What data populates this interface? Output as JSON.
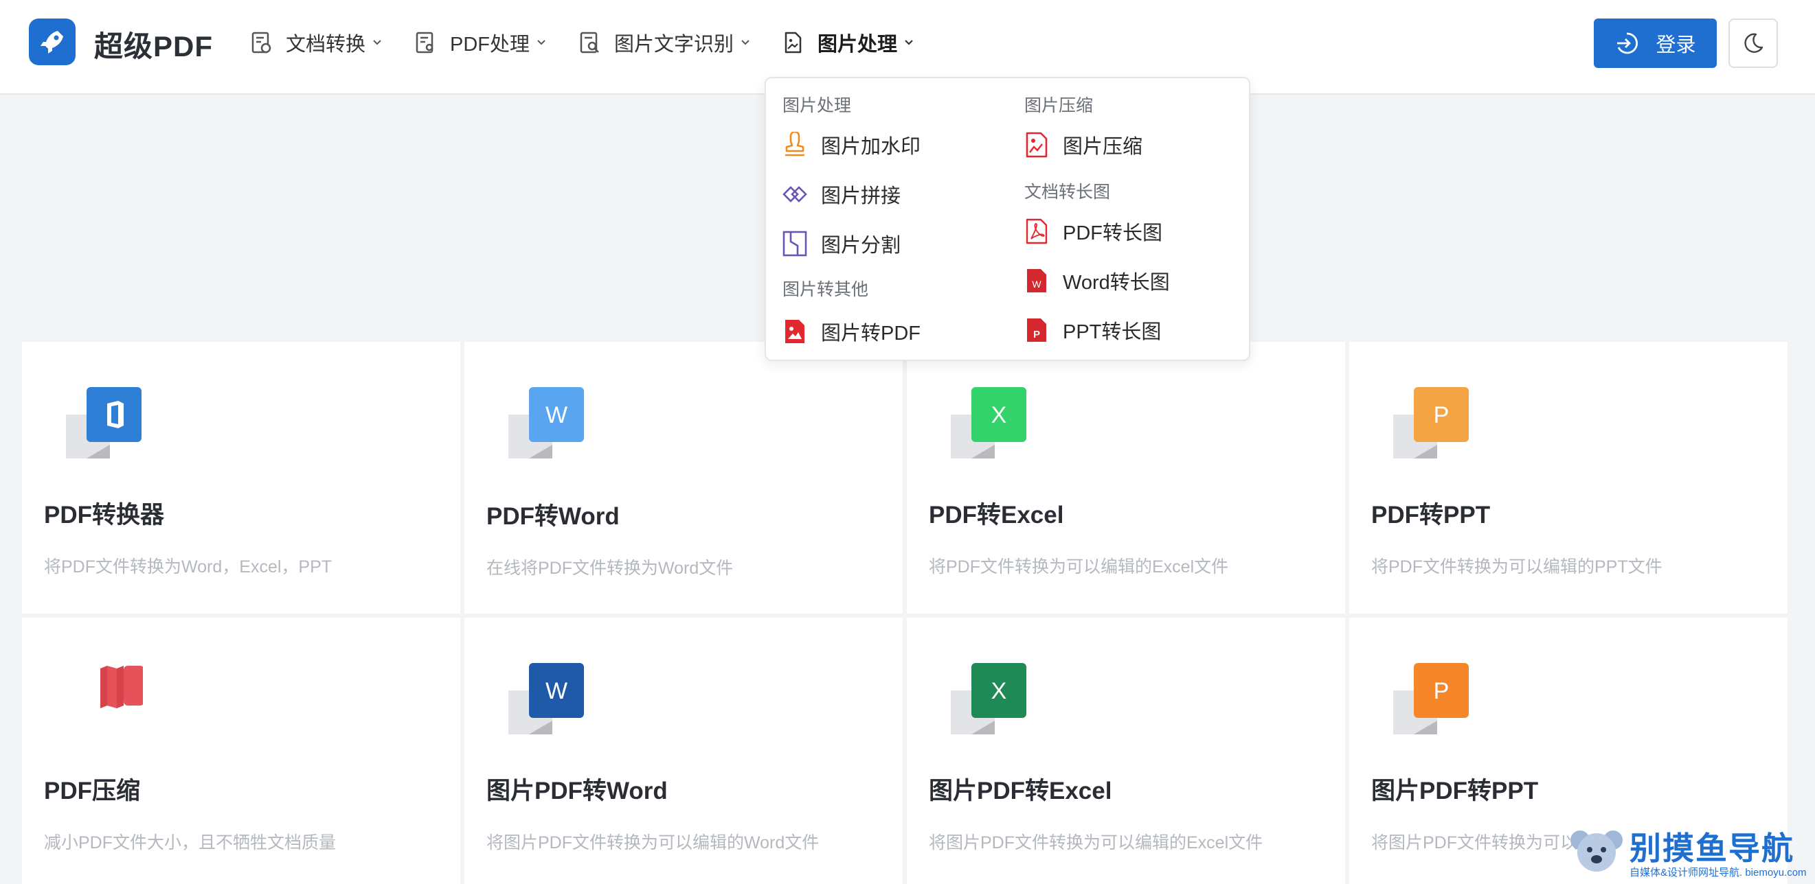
{
  "brand": {
    "name": "超级PDF"
  },
  "nav": {
    "items": [
      {
        "label": "文档转换"
      },
      {
        "label": "PDF处理"
      },
      {
        "label": "图片文字识别"
      },
      {
        "label": "图片处理"
      }
    ]
  },
  "header": {
    "login_label": "登录"
  },
  "dropdown": {
    "groups": {
      "image_processing": "图片处理",
      "image_to_other": "图片转其他",
      "image_compress": "图片压缩",
      "doc_to_long": "文档转长图"
    },
    "items": {
      "watermark": "图片加水印",
      "stitch": "图片拼接",
      "split": "图片分割",
      "img_to_pdf": "图片转PDF",
      "compress": "图片压缩",
      "pdf_long": "PDF转长图",
      "word_long": "Word转长图",
      "ppt_long": "PPT转长图"
    }
  },
  "cards": [
    {
      "title": "PDF转换器",
      "desc": "将PDF文件转换为Word，Excel，PPT",
      "icon": "office-icon"
    },
    {
      "title": "PDF转Word",
      "desc": "在线将PDF文件转换为Word文件",
      "icon": "W"
    },
    {
      "title": "PDF转Excel",
      "desc": "将PDF文件转换为可以编辑的Excel文件",
      "icon": "X"
    },
    {
      "title": "PDF转PPT",
      "desc": "将PDF文件转换为可以编辑的PPT文件",
      "icon": "P"
    },
    {
      "title": "PDF压缩",
      "desc": "减小PDF文件大小，且不牺牲文档质量",
      "icon": "compress-icon"
    },
    {
      "title": "图片PDF转Word",
      "desc": "将图片PDF文件转换为可以编辑的Word文件",
      "icon": "W"
    },
    {
      "title": "图片PDF转Excel",
      "desc": "将图片PDF文件转换为可以编辑的Excel文件",
      "icon": "X"
    },
    {
      "title": "图片PDF转PPT",
      "desc": "将图片PDF文件转换为可以",
      "icon": "P"
    }
  ],
  "watermark": {
    "text": "别摸鱼导航",
    "sub": "自媒体&设计师网址导航. biemoyu.com"
  },
  "colors": {
    "accent": "#1f6fd1",
    "word_light": "#5aa5f0",
    "excel_light": "#34d26b",
    "ppt_light": "#f5a444",
    "word_dark": "#1f5aa8",
    "excel_dark": "#1f8a55",
    "ppt_dark": "#f5872a",
    "office": "#2f7fd6",
    "compress": "#e5525a"
  }
}
